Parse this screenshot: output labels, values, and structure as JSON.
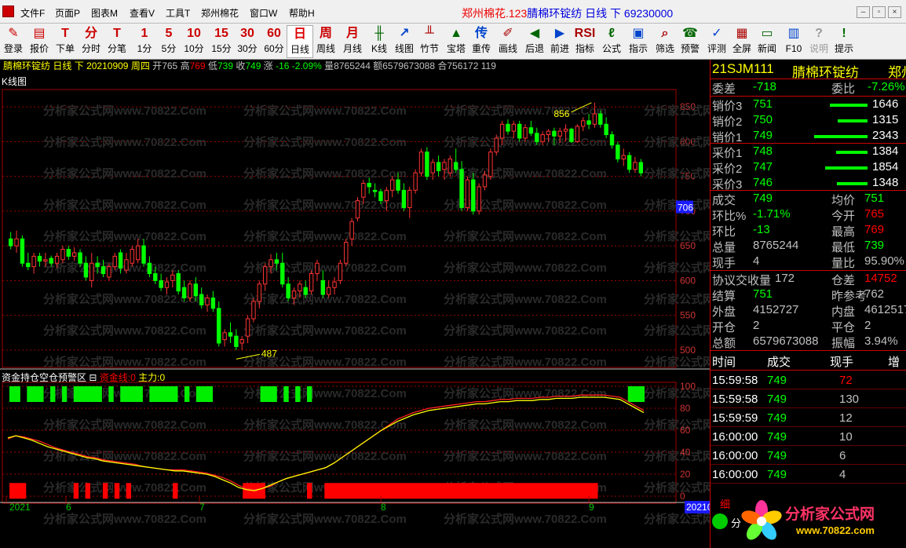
{
  "menu": [
    "文件F",
    "页面P",
    "图表M",
    "查看V",
    "工具T",
    "郑州棉花",
    "窗口W",
    "帮助H"
  ],
  "title": {
    "market": "郑州棉花.123",
    "name": "腈棉环锭纺",
    "period": "日线",
    "mode": "下",
    "number": "69230000"
  },
  "window_controls": [
    "–",
    "▫",
    "×"
  ],
  "toolbar": [
    {
      "icon": "✎",
      "label": "登录"
    },
    {
      "icon": "▤",
      "label": "报价"
    },
    {
      "icon": "T",
      "label": "下单"
    },
    {
      "icon": "分",
      "label": "分时"
    },
    {
      "icon": "T",
      "label": "分笔"
    },
    {
      "icon": "1",
      "label": "1分"
    },
    {
      "icon": "5",
      "label": "5分"
    },
    {
      "icon": "10",
      "label": "10分"
    },
    {
      "icon": "15",
      "label": "15分"
    },
    {
      "icon": "30",
      "label": "30分"
    },
    {
      "icon": "60",
      "label": "60分"
    },
    {
      "icon": "日",
      "label": "日线"
    },
    {
      "icon": "周",
      "label": "周线"
    },
    {
      "icon": "月",
      "label": "月线"
    },
    {
      "icon": "╫",
      "label": "K线"
    },
    {
      "icon": "↗",
      "label": "线图"
    },
    {
      "icon": "╨",
      "label": "竹节"
    },
    {
      "icon": "▲",
      "label": "宝塔"
    },
    {
      "icon": "传",
      "label": "重传"
    },
    {
      "icon": "✐",
      "label": "画线"
    },
    {
      "icon": "◀",
      "label": "后退"
    },
    {
      "icon": "▶",
      "label": "前进"
    },
    {
      "icon": "RSI",
      "label": "指标"
    },
    {
      "icon": "ℓ",
      "label": "公式"
    },
    {
      "icon": "▣",
      "label": "指示"
    },
    {
      "icon": "⌕",
      "label": "筛选"
    },
    {
      "icon": "☎",
      "label": "预警"
    },
    {
      "icon": "✓",
      "label": "评测"
    },
    {
      "icon": "▦",
      "label": "全屏"
    },
    {
      "icon": "▭",
      "label": "新闻"
    },
    {
      "icon": "▥",
      "label": "F10"
    },
    {
      "icon": "?",
      "label": "说明"
    },
    {
      "icon": "!",
      "label": "提示"
    }
  ],
  "info": {
    "name": "腈棉环锭纺",
    "period": "日线",
    "mode": "下",
    "date": "20210909",
    "weekday": "周四",
    "open_label": "开",
    "open": "765",
    "high_label": "高",
    "high": "769",
    "low_label": "低",
    "low": "739",
    "close_label": "收",
    "close": "749",
    "change_label": "涨",
    "change": "-16",
    "change_pct": "-2.09%",
    "vol_label": "量",
    "vol": "8765244",
    "amt_label": "额",
    "amt": "6579673088",
    "oi_label": "合",
    "oi": "756172",
    "extra": "119"
  },
  "kpanel": {
    "title": "K线图",
    "hi_label": "856",
    "lo_label": "487",
    "current_price": "706",
    "yticks": [
      "850",
      "800",
      "750",
      "700",
      "650",
      "600",
      "550",
      "500"
    ]
  },
  "ind": {
    "title": "资金持仓空仓预警区",
    "p1": "资金线:0",
    "p2": "主力:0",
    "yticks": [
      "100",
      "80",
      "60",
      "40",
      "20",
      "0"
    ]
  },
  "xaxis": {
    "labels": [
      "2021",
      "6",
      "7",
      "8",
      "9"
    ],
    "right": "20210"
  },
  "watermark": "分析家公式网www.70822.Com",
  "quote": {
    "code": "21SJM111",
    "name": "腈棉环锭纺",
    "exch": "郑州",
    "wb_label": "委差",
    "wb": "-718",
    "wr_label": "委比",
    "wr": "-7.26%",
    "asks": [
      {
        "label": "销价3",
        "price": "751",
        "vol": "1646",
        "pct": 0.7
      },
      {
        "label": "销价2",
        "price": "750",
        "vol": "1315",
        "pct": 0.56
      },
      {
        "label": "销价1",
        "price": "749",
        "vol": "2343",
        "pct": 1.0
      }
    ],
    "bids": [
      {
        "label": "采价1",
        "price": "748",
        "vol": "1384",
        "pct": 0.59
      },
      {
        "label": "采价2",
        "price": "747",
        "vol": "1854",
        "pct": 0.79
      },
      {
        "label": "采价3",
        "price": "746",
        "vol": "1348",
        "pct": 0.58
      }
    ],
    "stats": [
      {
        "l": "成交",
        "v": "749",
        "vc": "#0f0",
        "l2": "均价",
        "v2": "751",
        "v2c": "#0f0"
      },
      {
        "l": "环比%",
        "v": "-1.71%",
        "vc": "#0f0",
        "l2": "今开",
        "v2": "765",
        "v2c": "#f00"
      },
      {
        "l": "环比",
        "v": "-13",
        "vc": "#0f0",
        "l2": "最高",
        "v2": "769",
        "v2c": "#f00"
      },
      {
        "l": "总量",
        "v": "8765244",
        "vc": "#c0c0c0",
        "l2": "最低",
        "v2": "739",
        "v2c": "#0f0"
      },
      {
        "l": "现手",
        "v": "4",
        "vc": "#c0c0c0",
        "l2": "量比",
        "v2": "95.90%",
        "v2c": "#c0c0c0"
      },
      {
        "l": "协议交收量",
        "v": "172",
        "vc": "#c0c0c0",
        "l2": "仓差",
        "v2": "14752",
        "v2c": "#f00"
      },
      {
        "l": "结算",
        "v": "751",
        "vc": "#0f0",
        "l2": "昨参考",
        "v2": "762",
        "v2c": "#c0c0c0"
      },
      {
        "l": "外盘",
        "v": "4152727",
        "vc": "#c0c0c0",
        "l2": "内盘",
        "v2": "4612517",
        "v2c": "#c0c0c0"
      },
      {
        "l": "开仓",
        "v": "2",
        "vc": "#c0c0c0",
        "l2": "平仓",
        "v2": "2",
        "v2c": "#c0c0c0"
      },
      {
        "l": "总额",
        "v": "6579673088",
        "vc": "#c0c0c0",
        "l2": "振幅",
        "v2": "3.94%",
        "v2c": "#c0c0c0"
      }
    ],
    "tick_headers": [
      "时间",
      "成交",
      "现手",
      "增"
    ],
    "ticks": [
      {
        "time": "15:59:58",
        "price": "749",
        "hand": "72",
        "hc": "#f00"
      },
      {
        "time": "15:59:58",
        "price": "749",
        "hand": "130",
        "hc": "#c0c0c0"
      },
      {
        "time": "15:59:59",
        "price": "749",
        "hand": "12",
        "hc": "#c0c0c0"
      },
      {
        "time": "16:00:00",
        "price": "749",
        "hand": "10",
        "hc": "#c0c0c0"
      },
      {
        "time": "16:00:00",
        "price": "749",
        "hand": "6",
        "hc": "#c0c0c0"
      },
      {
        "time": "16:00:00",
        "price": "749",
        "hand": "4",
        "hc": "#c0c0c0"
      }
    ],
    "tab": "细",
    "bottom": "分"
  },
  "logo": {
    "text": "分析家公式网",
    "url": "www.70822.com"
  },
  "colors": {
    "up": "#ff3333",
    "down": "#00ff00",
    "grid": "#a00000",
    "accent": "#ffff00"
  },
  "chart_data": {
    "type": "candlestick",
    "ylim": [
      475,
      875
    ],
    "candles": [
      [
        660,
        670,
        645,
        650
      ],
      [
        650,
        672,
        640,
        660
      ],
      [
        660,
        665,
        620,
        625
      ],
      [
        625,
        640,
        615,
        620
      ],
      [
        620,
        640,
        610,
        635
      ],
      [
        635,
        640,
        620,
        628
      ],
      [
        628,
        640,
        620,
        630
      ],
      [
        632,
        636,
        620,
        625
      ],
      [
        625,
        640,
        618,
        635
      ],
      [
        630,
        650,
        625,
        645
      ],
      [
        645,
        650,
        630,
        635
      ],
      [
        635,
        648,
        628,
        640
      ],
      [
        640,
        645,
        620,
        625
      ],
      [
        625,
        635,
        600,
        605
      ],
      [
        600,
        640,
        590,
        625
      ],
      [
        625,
        635,
        610,
        620
      ],
      [
        620,
        630,
        605,
        610
      ],
      [
        605,
        625,
        600,
        620
      ],
      [
        620,
        640,
        615,
        635
      ],
      [
        640,
        645,
        610,
        618
      ],
      [
        615,
        640,
        610,
        630
      ],
      [
        625,
        650,
        620,
        645
      ],
      [
        630,
        660,
        625,
        650
      ],
      [
        650,
        660,
        620,
        625
      ],
      [
        625,
        635,
        605,
        610
      ],
      [
        610,
        620,
        595,
        600
      ],
      [
        600,
        610,
        585,
        590
      ],
      [
        590,
        605,
        580,
        598
      ],
      [
        600,
        615,
        590,
        608
      ],
      [
        610,
        615,
        580,
        585
      ],
      [
        590,
        600,
        570,
        575
      ],
      [
        575,
        600,
        570,
        595
      ],
      [
        595,
        605,
        570,
        578
      ],
      [
        580,
        590,
        560,
        565
      ],
      [
        565,
        580,
        555,
        575
      ],
      [
        575,
        585,
        555,
        560
      ],
      [
        560,
        570,
        505,
        510
      ],
      [
        515,
        530,
        505,
        525
      ],
      [
        525,
        540,
        510,
        520
      ],
      [
        520,
        530,
        500,
        505
      ],
      [
        510,
        520,
        500,
        515
      ],
      [
        520,
        550,
        510,
        545
      ],
      [
        545,
        575,
        540,
        570
      ],
      [
        570,
        600,
        560,
        595
      ],
      [
        595,
        625,
        585,
        620
      ],
      [
        620,
        638,
        610,
        630
      ],
      [
        630,
        640,
        615,
        625
      ],
      [
        625,
        640,
        590,
        595
      ],
      [
        595,
        605,
        570,
        575
      ],
      [
        575,
        590,
        565,
        585
      ],
      [
        585,
        600,
        575,
        595
      ],
      [
        590,
        600,
        575,
        580
      ],
      [
        585,
        615,
        580,
        610
      ],
      [
        610,
        630,
        600,
        625
      ],
      [
        600,
        615,
        575,
        580
      ],
      [
        580,
        600,
        575,
        590
      ],
      [
        590,
        605,
        580,
        598
      ],
      [
        600,
        630,
        595,
        625
      ],
      [
        625,
        660,
        620,
        655
      ],
      [
        660,
        690,
        650,
        685
      ],
      [
        690,
        720,
        685,
        715
      ],
      [
        720,
        745,
        710,
        740
      ],
      [
        740,
        748,
        725,
        735
      ],
      [
        730,
        740,
        720,
        728
      ],
      [
        728,
        732,
        710,
        715
      ],
      [
        715,
        735,
        700,
        730
      ],
      [
        730,
        750,
        720,
        745
      ],
      [
        745,
        755,
        725,
        730
      ],
      [
        730,
        740,
        700,
        705
      ],
      [
        705,
        735,
        690,
        730
      ],
      [
        730,
        760,
        725,
        755
      ],
      [
        755,
        790,
        750,
        785
      ],
      [
        785,
        792,
        745,
        750
      ],
      [
        755,
        775,
        745,
        770
      ],
      [
        770,
        780,
        750,
        758
      ],
      [
        760,
        775,
        745,
        770
      ],
      [
        755,
        780,
        750,
        775
      ],
      [
        770,
        790,
        755,
        760
      ],
      [
        760,
        772,
        700,
        705
      ],
      [
        705,
        750,
        700,
        745
      ],
      [
        745,
        755,
        695,
        700
      ],
      [
        700,
        740,
        695,
        735
      ],
      [
        735,
        758,
        730,
        752
      ],
      [
        750,
        790,
        745,
        785
      ],
      [
        785,
        810,
        780,
        805
      ],
      [
        805,
        830,
        795,
        825
      ],
      [
        825,
        832,
        810,
        815
      ],
      [
        815,
        830,
        805,
        825
      ],
      [
        825,
        830,
        800,
        805
      ],
      [
        805,
        825,
        800,
        820
      ],
      [
        820,
        830,
        808,
        812
      ],
      [
        812,
        820,
        795,
        800
      ],
      [
        800,
        815,
        795,
        810
      ],
      [
        810,
        818,
        800,
        815
      ],
      [
        815,
        820,
        795,
        808
      ],
      [
        808,
        820,
        798,
        815
      ],
      [
        815,
        825,
        800,
        818
      ],
      [
        818,
        820,
        798,
        800
      ],
      [
        800,
        825,
        798,
        822
      ],
      [
        822,
        835,
        815,
        830
      ],
      [
        830,
        840,
        818,
        825
      ],
      [
        825,
        856,
        820,
        840
      ],
      [
        840,
        845,
        820,
        825
      ],
      [
        825,
        835,
        805,
        810
      ],
      [
        810,
        815,
        790,
        795
      ],
      [
        795,
        800,
        770,
        775
      ],
      [
        775,
        790,
        765,
        780
      ],
      [
        780,
        785,
        755,
        760
      ],
      [
        760,
        778,
        755,
        770
      ],
      [
        770,
        775,
        750,
        755
      ]
    ],
    "capital_line": [
      52,
      55,
      54,
      52,
      50,
      47,
      44,
      42,
      40,
      38,
      36,
      35,
      33,
      32,
      31,
      30,
      29,
      27,
      26,
      25,
      24,
      24,
      24,
      23,
      22,
      21,
      19,
      17,
      14,
      10,
      7,
      6,
      7,
      9,
      13,
      16,
      18,
      20,
      22,
      24,
      26,
      30,
      35,
      40,
      45,
      50,
      55,
      60,
      65,
      70,
      73,
      76,
      78,
      80,
      81,
      82,
      83,
      84,
      85,
      86,
      86,
      87,
      88,
      88,
      89,
      89,
      89,
      90,
      90,
      91,
      91,
      91,
      92,
      92,
      92,
      92,
      91,
      90,
      86,
      82,
      78
    ],
    "main_line": [
      53,
      55,
      53,
      51,
      48,
      45,
      43,
      41,
      39,
      37,
      35,
      34,
      32,
      31,
      30,
      29,
      28,
      27,
      26,
      25,
      24,
      23,
      23,
      22,
      21,
      20,
      18,
      15,
      12,
      8,
      6,
      5,
      7,
      10,
      13,
      16,
      18,
      20,
      22,
      24,
      26,
      30,
      35,
      40,
      45,
      50,
      55,
      60,
      64,
      68,
      71,
      74,
      76,
      78,
      79,
      80,
      81,
      82,
      83,
      84,
      84,
      85,
      86,
      86,
      87,
      87,
      87,
      88,
      88,
      89,
      89,
      89,
      90,
      90,
      90,
      90,
      89,
      88,
      84,
      80,
      76
    ],
    "top_green": [
      [
        0,
        2
      ],
      [
        3,
        6
      ],
      [
        7,
        8
      ],
      [
        9,
        10
      ],
      [
        11,
        16
      ],
      [
        17,
        18
      ],
      [
        19,
        23
      ],
      [
        24,
        29
      ],
      [
        30,
        31
      ],
      [
        32,
        35
      ],
      [
        43,
        46
      ],
      [
        47,
        48
      ],
      [
        49,
        50
      ],
      [
        51,
        52
      ],
      [
        106,
        109
      ]
    ],
    "bottom_red": [
      [
        0,
        3
      ],
      [
        11,
        12
      ],
      [
        13,
        14
      ],
      [
        16,
        17
      ],
      [
        18,
        19
      ],
      [
        20,
        21
      ],
      [
        28,
        29
      ],
      [
        40,
        44
      ],
      [
        51,
        52
      ],
      [
        54,
        101
      ]
    ]
  }
}
